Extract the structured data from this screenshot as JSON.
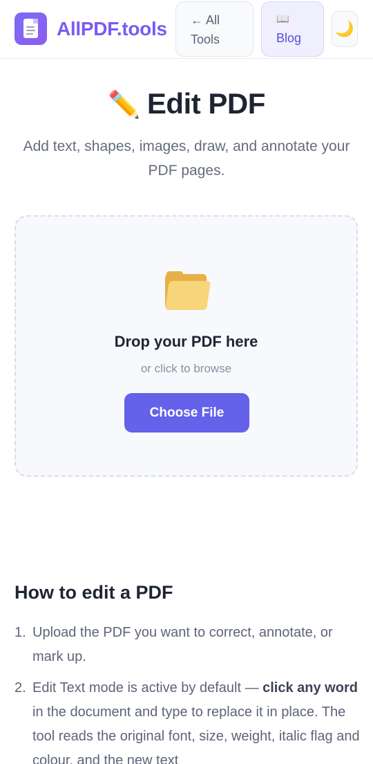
{
  "header": {
    "brand": "AllPDF.tools",
    "nav_all_tools_line1": "← All",
    "nav_all_tools_line2": "Tools",
    "nav_blog_icon": "📖",
    "nav_blog_label": "Blog",
    "theme_icon": "🌙"
  },
  "hero": {
    "title_emoji": "✏️",
    "title": "Edit PDF",
    "subtitle": "Add text, shapes, images, draw, and annotate your PDF pages."
  },
  "dropzone": {
    "title": "Drop your PDF here",
    "subtitle": "or click to browse",
    "button": "Choose File"
  },
  "howto": {
    "title": "How to edit a PDF",
    "steps": [
      {
        "num": "1.",
        "text": "Upload the PDF you want to correct, annotate, or mark up."
      },
      {
        "num": "2.",
        "before": "Edit Text mode is active by default — ",
        "bold": "click any word",
        "after": " in the document and type to replace it in place. The tool reads the original font, size, weight, italic flag and colour, and the new text"
      }
    ]
  },
  "colors": {
    "accent": "#6461ea",
    "brand": "#7a5cf0",
    "text": "#1e2433",
    "muted": "#646b7e"
  }
}
